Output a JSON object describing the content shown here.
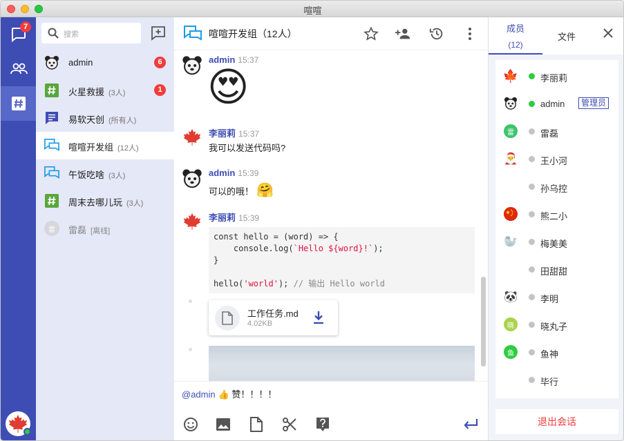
{
  "window": {
    "title": "喧喧"
  },
  "rail": {
    "chat_badge": "7",
    "colors": {
      "bg": "#3e4db3",
      "active": "#5868c8"
    }
  },
  "convlist": {
    "search_placeholder": "搜索",
    "items": [
      {
        "name": "admin",
        "sub": "",
        "badge": "6",
        "icon": "bear-avatar"
      },
      {
        "name": "火星救援",
        "sub": "(3人)",
        "badge": "1",
        "icon": "hashtag-icon"
      },
      {
        "name": "易软天创",
        "sub": "(所有人)",
        "badge": "",
        "icon": "notice-icon"
      },
      {
        "name": "喧喧开发组",
        "sub": "(12人)",
        "badge": "",
        "icon": "group-chat-icon"
      },
      {
        "name": "午饭吃啥",
        "sub": "(3人)",
        "badge": "",
        "icon": "group-chat-icon"
      },
      {
        "name": "周末去哪儿玩",
        "sub": "(3人)",
        "badge": "",
        "icon": "hashtag-icon"
      },
      {
        "name": "雷磊",
        "sub": "[离线]",
        "badge": "",
        "icon": "letter-avatar",
        "avatar_text": "雷"
      }
    ]
  },
  "chat": {
    "title": "喧喧开发组（12人）",
    "messages": [
      {
        "nick": "admin",
        "time": "15:37",
        "type": "emoji",
        "emoji": "😍"
      },
      {
        "nick": "李丽莉",
        "time": "15:37",
        "type": "text",
        "text": "我可以发送代码吗?"
      },
      {
        "nick": "admin",
        "time": "15:39",
        "type": "text",
        "text": "可以的哦！",
        "emoji": "🤗"
      },
      {
        "nick": "李丽莉",
        "time": "15:39",
        "type": "code"
      }
    ],
    "code_lines": {
      "l1": "const hello = (word) => {",
      "l2a": "    console.log(",
      "l2b": "`Hello ${word}!`",
      "l2c": ");",
      "l3": "}",
      "l5a": "hello(",
      "l5b": "'world'",
      "l5c": "); ",
      "l5d": "// 输出 Hello world"
    },
    "file": {
      "name": "工作任务.md",
      "size": "4.02KB"
    },
    "input": {
      "mention": "@admin",
      "emoji": "👍",
      "text": " 赞！！！！"
    }
  },
  "panel": {
    "tab_members": "成员",
    "tab_members_count": "(12)",
    "tab_files": "文件",
    "admin_tag": "管理员",
    "leave_label": "退出会话",
    "members": [
      {
        "name": "李丽莉",
        "online": true,
        "avatar": "🍁",
        "color": "#ffffff"
      },
      {
        "name": "admin",
        "online": true,
        "avatar": "bear",
        "color": "#ffffff",
        "admin": true
      },
      {
        "name": "雷磊",
        "online": false,
        "avatar": "雷",
        "color": "#3ec46d"
      },
      {
        "name": "王小河",
        "online": false,
        "avatar": "🎅",
        "color": "#ffffff"
      },
      {
        "name": "孙乌控",
        "online": false,
        "avatar": "🐵",
        "color": "#ffffff"
      },
      {
        "name": "熊二小",
        "online": false,
        "avatar": "🇨🇳",
        "color": "#ffffff"
      },
      {
        "name": "梅美美",
        "online": false,
        "avatar": "🦭",
        "color": "#ffffff"
      },
      {
        "name": "田甜甜",
        "online": false,
        "avatar": "🙀",
        "color": "#ffffff"
      },
      {
        "name": "李明",
        "online": false,
        "avatar": "🐼",
        "color": "#ffffff"
      },
      {
        "name": "晓丸子",
        "online": false,
        "avatar": "晓",
        "color": "#a8d44a"
      },
      {
        "name": "鱼神",
        "online": false,
        "avatar": "鱼",
        "color": "#2ecc40"
      },
      {
        "name": "毕行",
        "online": false,
        "avatar": "😳",
        "color": "#ffffff"
      }
    ]
  },
  "colors": {
    "accent": "#3e4db3",
    "badge": "#f03c3c",
    "online": "#2ecc40"
  }
}
